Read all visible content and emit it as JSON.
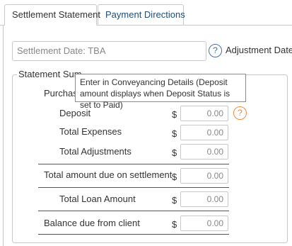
{
  "tabs": [
    {
      "label": "Settlement Statement",
      "active": true
    },
    {
      "label": "Payment Directions",
      "active": false
    }
  ],
  "settlement_date": {
    "value": "Settlement Date: TBA"
  },
  "help_icon_glyph": "?",
  "adjustment_date_label": "Adjustment Date",
  "statement_summary": {
    "legend": "Statement Sum",
    "purchase_label": "Purchase",
    "currency_symbol": "$",
    "rows": {
      "deposit": {
        "label": "Deposit",
        "value": "0.00"
      },
      "total_expenses": {
        "label": "Total Expenses",
        "value": "0.00"
      },
      "total_adjustments": {
        "label": "Total Adjustments",
        "value": "0.00"
      },
      "total_due": {
        "label": "Total amount due on settlement",
        "value": "0.00"
      },
      "total_loan": {
        "label": "Total Loan Amount",
        "value": "0.00"
      },
      "balance_due": {
        "label": "Balance due from client",
        "value": "0.00"
      }
    }
  },
  "tooltip": {
    "text": "Enter in Conveyancing Details (Deposit amount displays when Deposit Status is set to Paid)"
  },
  "colors": {
    "border": "#c8c8c8",
    "help_blue": "#4a6fa5",
    "help_orange": "#f08a3e",
    "text": "#333333",
    "placeholder_text": "#888888"
  },
  "icons": {
    "help_blue": "help-circle-icon",
    "help_orange": "info-circle-icon"
  }
}
